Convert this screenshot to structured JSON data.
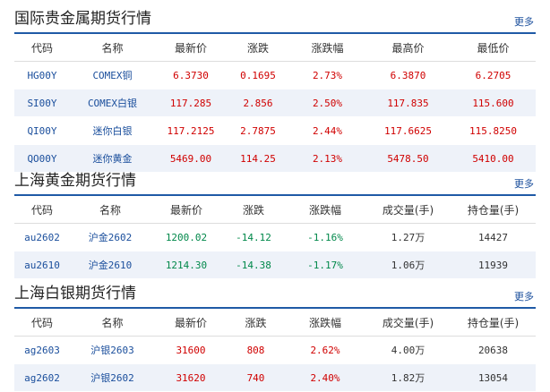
{
  "sections": [
    {
      "title": "国际贵金属期货行情",
      "more": "更多",
      "headers": [
        "代码",
        "名称",
        "最新价",
        "涨跌",
        "涨跌幅",
        "最高价",
        "最低价"
      ],
      "rows": [
        [
          "HG00Y",
          "COMEX铜",
          "6.3730",
          "0.1695",
          "2.73%",
          "6.3870",
          "6.2705"
        ],
        [
          "SI00Y",
          "COMEX白银",
          "117.285",
          "2.856",
          "2.50%",
          "117.835",
          "115.600"
        ],
        [
          "QI00Y",
          "迷你白银",
          "117.2125",
          "2.7875",
          "2.44%",
          "117.6625",
          "115.8250"
        ],
        [
          "QO00Y",
          "迷你黄金",
          "5469.00",
          "114.25",
          "2.13%",
          "5478.50",
          "5410.00"
        ]
      ]
    },
    {
      "title": "上海黄金期货行情",
      "more": "更多",
      "headers": [
        "代码",
        "名称",
        "最新价",
        "涨跌",
        "涨跌幅",
        "成交量(手)",
        "持仓量(手)"
      ],
      "rows": [
        [
          "au2602",
          "沪金2602",
          "1200.02",
          "-14.12",
          "-1.16%",
          "1.27万",
          "14427"
        ],
        [
          "au2610",
          "沪金2610",
          "1214.30",
          "-14.38",
          "-1.17%",
          "1.06万",
          "11939"
        ]
      ]
    },
    {
      "title": "上海白银期货行情",
      "more": "更多",
      "headers": [
        "代码",
        "名称",
        "最新价",
        "涨跌",
        "涨跌幅",
        "成交量(手)",
        "持仓量(手)"
      ],
      "rows": [
        [
          "ag2603",
          "沪银2603",
          "31600",
          "808",
          "2.62%",
          "4.00万",
          "20638"
        ],
        [
          "ag2602",
          "沪银2602",
          "31620",
          "740",
          "2.40%",
          "1.82万",
          "13054"
        ]
      ]
    }
  ],
  "colors": {
    "accent": "#1f5aa6",
    "up": "#d00000",
    "down": "#00884a",
    "link": "#1a4e9c",
    "row_alt": "#eef2f9"
  }
}
